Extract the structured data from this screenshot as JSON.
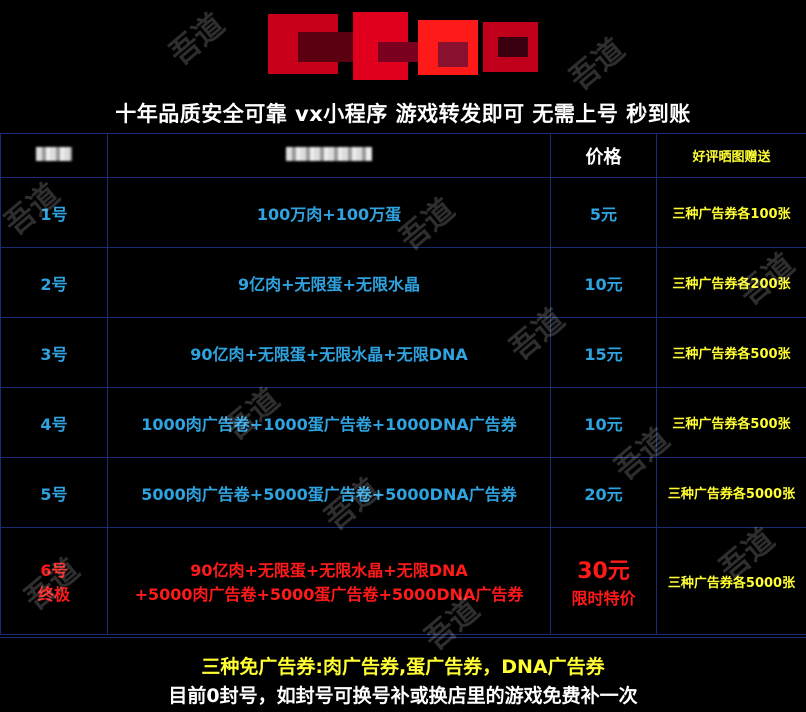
{
  "headline": "十年品质安全可靠   vx小程序   游戏转发即可   无需上号     秒到账",
  "header": {
    "price": "价格",
    "gift": "好评晒图赠送"
  },
  "rows": [
    {
      "id": "1号",
      "content": "100万肉+100万蛋",
      "price": "5元",
      "gift": "三种广告券各100张"
    },
    {
      "id": "2号",
      "content": "9亿肉+无限蛋+无限水晶",
      "price": "10元",
      "gift": "三种广告券各200张"
    },
    {
      "id": "3号",
      "content": "90亿肉+无限蛋+无限水晶+无限DNA",
      "price": "15元",
      "gift": "三种广告券各500张"
    },
    {
      "id": "4号",
      "content": "1000肉广告卷+1000蛋广告卷+1000DNA广告券",
      "price": "10元",
      "gift": "三种广告券各500张"
    },
    {
      "id": "5号",
      "content": "5000肉广告卷+5000蛋广告卷+5000DNA广告券",
      "price": "20元",
      "gift": "三种广告券各5000张"
    }
  ],
  "special": {
    "id_line1": "6号",
    "id_line2": "终极",
    "content_line1": "90亿肉+无限蛋+无限水晶+无限DNA",
    "content_line2": "+5000肉广告卷+5000蛋广告卷+5000DNA广告券",
    "price_line1": "30元",
    "price_line2": "限时特价",
    "gift": "三种广告券各5000张"
  },
  "footer": {
    "line1": "三种免广告券:肉广告券,蛋广告券，DNA广告券",
    "line2": "目前0封号，如封号可换号补或换店里的游戏免费补一次"
  },
  "watermark": "吾道",
  "colors": {
    "blue": "#2fa3e0",
    "red": "#ff1a1a",
    "yellow": "#ffff33",
    "grid": "#1a2b73"
  }
}
